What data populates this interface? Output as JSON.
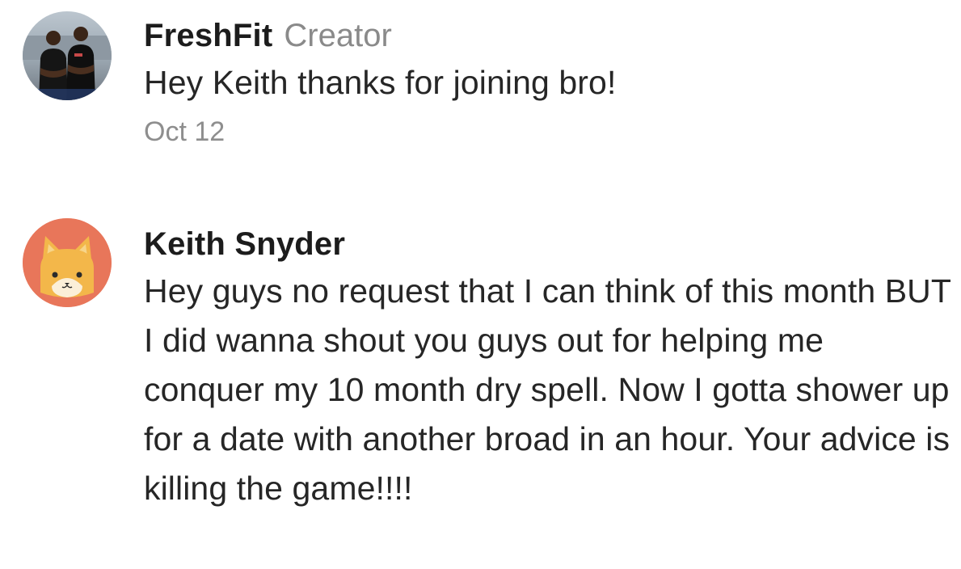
{
  "comments": [
    {
      "author": "FreshFit",
      "role": "Creator",
      "text": "Hey Keith thanks for joining bro!",
      "timestamp": "Oct 12",
      "avatar": "photo-avatar"
    },
    {
      "author": "Keith Snyder",
      "text": "Hey guys no request that I can think of this month BUT I did wanna shout you guys out for helping me conquer my 10 month dry spell. Now I gotta shower up for a date with another broad in an hour. Your advice is killing the game!!!!",
      "avatar": "cat-avatar-icon"
    }
  ],
  "colors": {
    "cat_avatar_bg": "#e8765a",
    "cat_face": "#f3b74a",
    "muted_text": "#8a8a8a"
  }
}
